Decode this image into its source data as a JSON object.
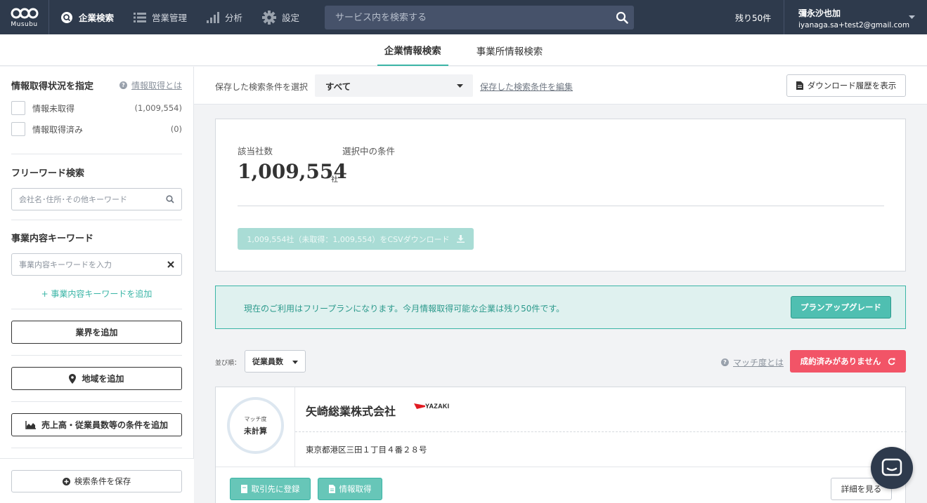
{
  "app": {
    "logo_text": "Musubu"
  },
  "nav": {
    "items": [
      {
        "label": "企業検索",
        "icon": "search-circle-icon",
        "active": true
      },
      {
        "label": "営業管理",
        "icon": "list-icon",
        "active": false
      },
      {
        "label": "分析",
        "icon": "bar-chart-icon",
        "active": false
      },
      {
        "label": "設定",
        "icon": "gear-icon",
        "active": false
      }
    ],
    "search_placeholder": "サービス内を検索する",
    "remaining": "残り50件",
    "user": {
      "name": "彌永沙也加",
      "email": "iyanaga.sa+test2@gmail.com"
    }
  },
  "tabs": [
    {
      "label": "企業情報検索",
      "active": true
    },
    {
      "label": "事業所情報検索",
      "active": false
    }
  ],
  "sidebar": {
    "status": {
      "title": "情報取得状況を指定",
      "help": "情報取得とは",
      "options": [
        {
          "label": "情報未取得",
          "count": "(1,009,554)"
        },
        {
          "label": "情報取得済み",
          "count": "(0)"
        }
      ]
    },
    "freeword": {
      "title": "フリーワード検索",
      "placeholder": "会社名･住所･その他キーワード"
    },
    "business": {
      "title": "事業内容キーワード",
      "placeholder": "事業内容キーワードを入力",
      "add": "+ 事業内容キーワードを追加"
    },
    "industry_btn": "業界を追加",
    "region_btn": "地域を追加",
    "sales_btn": "売上高・従業員数等の条件を追加",
    "save_btn": "検索条件を保存"
  },
  "conditions": {
    "label": "保存した検索条件を選択",
    "selected": "すべて",
    "edit": "保存した検索条件を編集",
    "download_history": "ダウンロード履歴を表示"
  },
  "summary": {
    "count_label": "該当社数",
    "selected_label": "選択中の条件",
    "count": "1,009,554",
    "unit": "社",
    "csv_button": "1,009,554社（未取得：1,009,554）をCSVダウンロード"
  },
  "plan": {
    "message": "現在のご利用はフリープランになります。今月情報取得可能な企業は残り50件です。",
    "upgrade": "プランアップグレード"
  },
  "list": {
    "sort_label": "並び順：",
    "sort_value": "従業員数",
    "match_help": "マッチ度とは",
    "deal_button": "成約済みがありません"
  },
  "company": {
    "match_label": "マッチ度",
    "match_value": "未計算",
    "name": "矢崎総業株式会社",
    "logo_text": "YAZAKI",
    "address": "東京都港区三田１丁目４番２８号",
    "register_btn": "取引先に登録",
    "info_btn": "情報取得",
    "detail_btn": "詳細を見る"
  },
  "colors": {
    "header": "#2e3a4c",
    "accent": "#3ab5a6",
    "danger": "#f25467"
  }
}
